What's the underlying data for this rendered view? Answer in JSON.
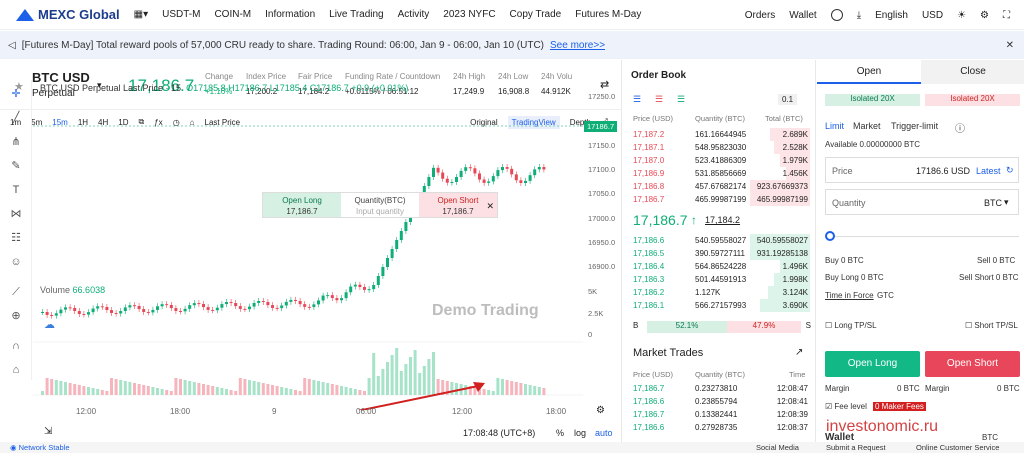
{
  "nav": {
    "logo": "MEXC Global",
    "items": [
      "USDT-M",
      "COIN-M",
      "Information",
      "Live Trading",
      "Activity",
      "2023 NYFC",
      "Copy Trade",
      "Futures M-Day"
    ],
    "right": [
      "Orders",
      "Wallet",
      "English",
      "USD"
    ]
  },
  "banner": {
    "text": "[Futures M-Day] Total reward pools of 57,000 CRU ready to share. Trading Round: 06:00, Jan 9 - 06:00, Jan 10 (UTC)",
    "link": "See more>>"
  },
  "ticker": {
    "symbol": "BTC USD",
    "type": "Perpetual",
    "last": "17,186.7",
    "stats": [
      {
        "label": "Change",
        "value": "+1.16%"
      },
      {
        "label": "Index Price",
        "value": "17,200.2"
      },
      {
        "label": "Fair Price",
        "value": "17,184.2"
      },
      {
        "label": "Funding Rate / Countdown",
        "value": "+0.0115% / 06:51:12"
      },
      {
        "label": "24h High",
        "value": "17,249.9"
      },
      {
        "label": "24h Low",
        "value": "16,908.8"
      },
      {
        "label": "24h Volu",
        "value": "44.912K"
      }
    ]
  },
  "toolbar": {
    "intervals": [
      "1m",
      "5m",
      "15m",
      "1H",
      "4H",
      "1D"
    ],
    "lastprice": "Last Price",
    "views": [
      "Original",
      "TradingView",
      "Depth"
    ]
  },
  "chart": {
    "ohlc_title": "BTC USD Perpetual Last Price · 15",
    "o": "O17185.8",
    "h": "H17186.7",
    "l": "L17185.4",
    "c": "C17186.7",
    "chg": "+0.9 (+0.01%)",
    "yticks": [
      "17250.0",
      "17200.0",
      "17150.0",
      "17100.0",
      "17050.0",
      "17000.0",
      "16950.0",
      "16900.0"
    ],
    "pricetag": "17186.7",
    "volume_label": "Volume",
    "volume_value": "66.6038",
    "vticks": [
      "5K",
      "2.5K",
      "0"
    ],
    "xticks": [
      "12:00",
      "18:00",
      "9",
      "06:00",
      "12:00",
      "18:00"
    ],
    "demo": "Demo Trading",
    "time": "17:08:48 (UTC+8)",
    "pct": "%",
    "log": "log",
    "auto": "auto"
  },
  "popup": {
    "long": "Open Long",
    "long_price": "17,186.7",
    "qty": "Quantity(BTC)",
    "qty_ph": "Input quantity",
    "short": "Open Short",
    "short_price": "17,186.7"
  },
  "orderbook": {
    "title": "Order Book",
    "step": "0.1",
    "head": [
      "Price (USD)",
      "Quantity (BTC)",
      "Total (BTC)"
    ],
    "asks": [
      [
        "17,187.2",
        "161.16644945",
        "2.689K"
      ],
      [
        "17,187.1",
        "548.95823030",
        "2.528K"
      ],
      [
        "17,187.0",
        "523.41886309",
        "1.979K"
      ],
      [
        "17,186.9",
        "531.85856669",
        "1.456K"
      ],
      [
        "17,186.8",
        "457.67682174",
        "923.67669373"
      ],
      [
        "17,186.7",
        "465.99987199",
        "465.99987199"
      ]
    ],
    "mid": "17,186.7",
    "mid2": "17,184.2",
    "bids": [
      [
        "17,186.6",
        "540.59558027",
        "540.59558027"
      ],
      [
        "17,186.5",
        "390.59727111",
        "931.19285138"
      ],
      [
        "17,186.4",
        "564.86524228",
        "1.496K"
      ],
      [
        "17,186.3",
        "501.44591913",
        "1.998K"
      ],
      [
        "17,186.2",
        "1.127K",
        "3.124K"
      ],
      [
        "17,186.1",
        "566.27157993",
        "3.690K"
      ]
    ],
    "buy_ratio": "52.1%",
    "sell_ratio": "47.9%",
    "b": "B",
    "s": "S"
  },
  "trades": {
    "title": "Market Trades",
    "head": [
      "Price (USD)",
      "Quantity (BTC)",
      "Time"
    ],
    "rows": [
      [
        "17,186.7",
        "0.23273810",
        "12:08:47"
      ],
      [
        "17,186.6",
        "0.23855794",
        "12:08:41"
      ],
      [
        "17,186.7",
        "0.13382441",
        "12:08:39"
      ],
      [
        "17,186.6",
        "0.27928735",
        "12:08:37"
      ]
    ]
  },
  "order": {
    "tabs": [
      "Open",
      "Close"
    ],
    "iso_long": "Isolated 20X",
    "iso_short": "Isolated 20X",
    "types": [
      "Limit",
      "Market",
      "Trigger-limit"
    ],
    "available": "Available 0.00000000 BTC",
    "price_label": "Price",
    "price_value": "17186.6 USD",
    "latest": "Latest",
    "qty_label": "Quantity",
    "qty_unit": "BTC",
    "buy": "Buy 0 BTC",
    "sell": "Sell 0 BTC",
    "buylong": "Buy Long 0 BTC",
    "sellshort": "Sell Short 0 BTC",
    "tif": "Time in Force",
    "tif_val": "GTC",
    "tpsl_long": "Long TP/SL",
    "tpsl_short": "Short TP/SL",
    "open_long": "Open Long",
    "open_short": "Open Short",
    "margin_l": "Margin",
    "margin_lv": "0 BTC",
    "margin_s": "Margin",
    "margin_sv": "0 BTC",
    "fee": "Fee level",
    "fee_badge": "0 Maker Fees",
    "wallet": "Wallet",
    "wallet_unit": "BTC"
  },
  "footer": {
    "network": "Network Stable",
    "social": "Social Media",
    "submit": "Submit a Request",
    "support": "Online Customer Service"
  },
  "watermark": "investonomic.ru"
}
